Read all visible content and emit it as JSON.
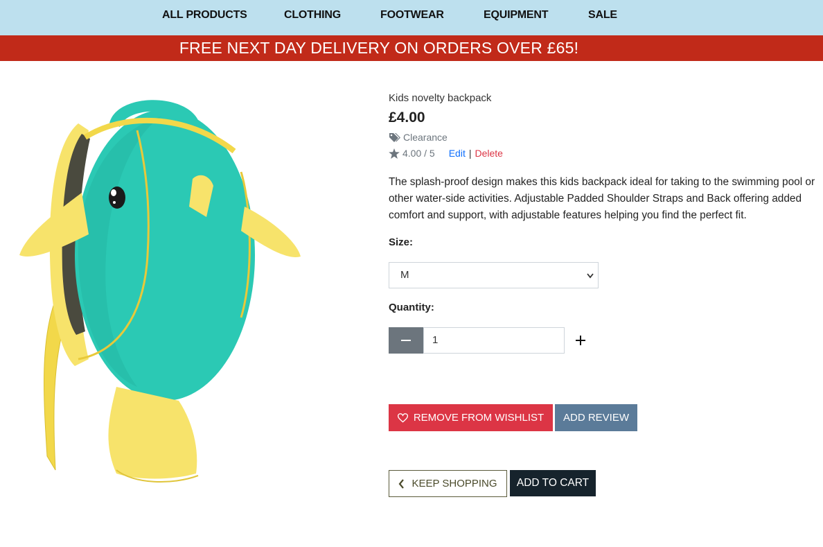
{
  "nav": {
    "items": [
      "ALL PRODUCTS",
      "CLOTHING",
      "FOOTWEAR",
      "EQUIPMENT",
      "SALE"
    ]
  },
  "banner": {
    "text": "FREE NEXT DAY DELIVERY ON ORDERS OVER £65!"
  },
  "product": {
    "name": "Kids novelty backpack",
    "price": "£4.00",
    "category": "Clearance",
    "rating": "4.00 / 5",
    "edit_label": "Edit",
    "separator": "|",
    "delete_label": "Delete",
    "description": "The splash-proof design makes this kids backpack ideal for taking to the swimming pool or other water-side activities. Adjustable Padded Shoulder Straps and Back offering added comfort and support, with adjustable features helping you find the perfect fit.",
    "image_alt": "Kids novelty backpack"
  },
  "form": {
    "size_label": "Size:",
    "size_value": "M",
    "quantity_label": "Quantity:",
    "quantity_value": "1",
    "minus_icon": "minus-icon",
    "plus_icon": "plus-icon"
  },
  "buttons": {
    "remove_wishlist": "REMOVE FROM WISHLIST",
    "add_review": "ADD REVIEW",
    "keep_shopping": "KEEP SHOPPING",
    "add_to_cart": "ADD TO CART"
  },
  "colors": {
    "nav_bg": "#bde0ee",
    "banner_bg": "#c12a19",
    "danger": "#dc3545",
    "review_btn": "#5b7b99",
    "cart_btn": "#16232c",
    "backpack_teal": "#2bc9b4",
    "backpack_yellow": "#f7e36b"
  }
}
